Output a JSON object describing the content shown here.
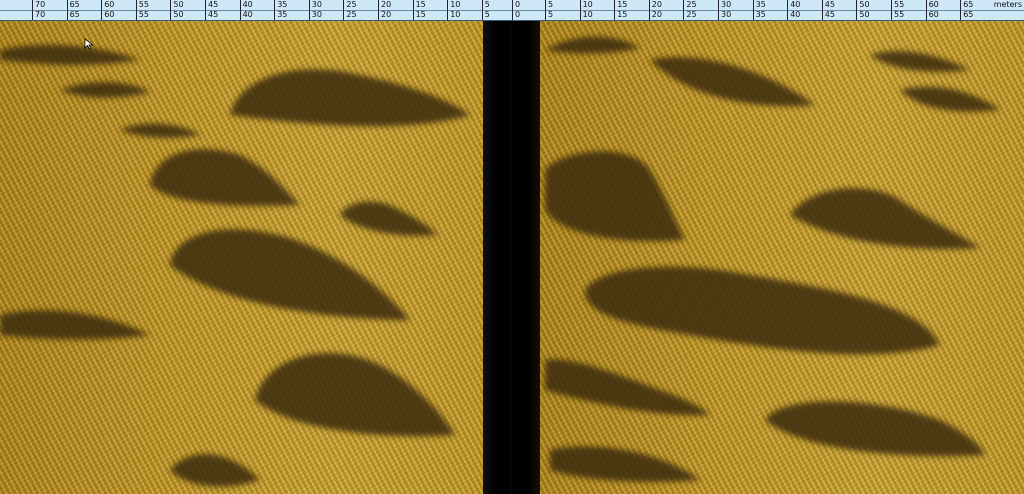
{
  "ruler": {
    "port_ticks": [
      "70",
      "65",
      "60",
      "55",
      "50",
      "45",
      "40",
      "35",
      "30",
      "25",
      "20",
      "15",
      "10",
      "5"
    ],
    "center_tick": "0",
    "starboard_ticks": [
      "5",
      "10",
      "15",
      "20",
      "25",
      "30",
      "35",
      "40",
      "45",
      "50",
      "55",
      "60",
      "65"
    ],
    "unit_label": "meters"
  },
  "colors": {
    "sediment": "#c89e2a",
    "shadow": "#3a2a08",
    "water_column": "#000000",
    "ruler_bg": "#cfe8f8"
  },
  "cursor": {
    "icon": "arrow-cursor-icon"
  }
}
